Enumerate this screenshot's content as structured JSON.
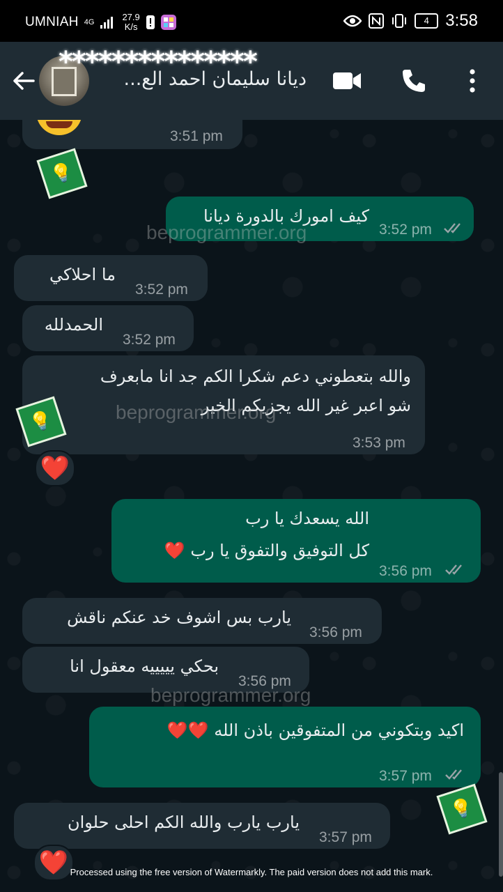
{
  "status_bar": {
    "carrier": "UMNIAH",
    "network": "4G",
    "speed_value": "27.9",
    "speed_unit": "K/s",
    "battery": "4",
    "time": "3:58"
  },
  "app_bar": {
    "contact_name": "ديانا سليمان احمد الع...",
    "masked_text": "***************",
    "icons": [
      "back-arrow-icon",
      "video-call-icon",
      "voice-call-icon",
      "more-vertical-icon"
    ]
  },
  "messages": [
    {
      "dir": "in",
      "text": "",
      "time": "3:51 pm",
      "reaction": "sticker"
    },
    {
      "dir": "out",
      "text": "كيف امورك بالدورة ديانا",
      "time": "3:52 pm",
      "read": true
    },
    {
      "dir": "in",
      "text": "ما احلاكي",
      "time": "3:52 pm"
    },
    {
      "dir": "in",
      "text": "الحمدلله",
      "time": "3:52 pm"
    },
    {
      "dir": "in",
      "lines": [
        "والله بتعطوني دعم شكرا الكم جد انا مابعرف",
        "شو اعبر غير الله يجزيكم الخير"
      ],
      "time": "3:53 pm",
      "reaction": "❤️"
    },
    {
      "dir": "out",
      "lines": [
        "الله يسعدك يا رب",
        "كل التوفيق والتفوق يا رب ❤️"
      ],
      "time": "3:56 pm",
      "read": true
    },
    {
      "dir": "in",
      "text": "يارب بس اشوف خد عنكم ناقش",
      "time": "3:56 pm"
    },
    {
      "dir": "in",
      "text": "بحكي يييييه معقول انا",
      "time": "3:56 pm"
    },
    {
      "dir": "out",
      "text": "اكيد وبتكوني من المتفوقين باذن الله ❤️❤️",
      "time": "3:57 pm",
      "read": true
    },
    {
      "dir": "in",
      "text": "يارب يارب والله الكم احلى حلوان",
      "time": "3:57 pm",
      "reaction": "❤️"
    }
  ],
  "watermark": "beprogrammer.org",
  "footer_note": "Processed using the free version of Watermarkly. The paid version does not add this mark.",
  "colors": {
    "incoming": "#1f2c34",
    "outgoing": "#005c4b",
    "background": "#0b141a",
    "heart": "#e8112d"
  }
}
